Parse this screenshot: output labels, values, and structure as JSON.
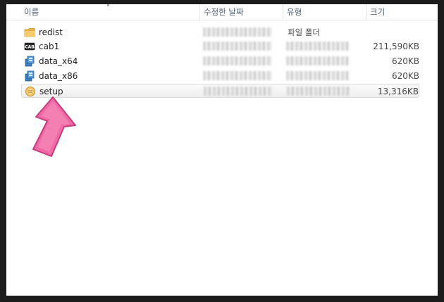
{
  "columns": {
    "name": "이름",
    "date_modified": "수정한 날짜",
    "type": "유형",
    "size": "크기"
  },
  "files": [
    {
      "name": "redist",
      "icon": "folder-icon",
      "type": "파일 폴더",
      "size": ""
    },
    {
      "name": "cab1",
      "icon": "cab-file-icon",
      "type": "",
      "size": "211,590KB"
    },
    {
      "name": "data_x64",
      "icon": "installer-file-icon",
      "type": "",
      "size": "620KB"
    },
    {
      "name": "data_x86",
      "icon": "installer-file-icon",
      "type": "",
      "size": "620KB"
    },
    {
      "name": "setup",
      "icon": "setup-app-icon",
      "type": "",
      "size": "13,316KB"
    }
  ],
  "colors": {
    "arrow": "#f06aa6",
    "selection": "#eeeeee",
    "frame": "#1c1c1c"
  }
}
